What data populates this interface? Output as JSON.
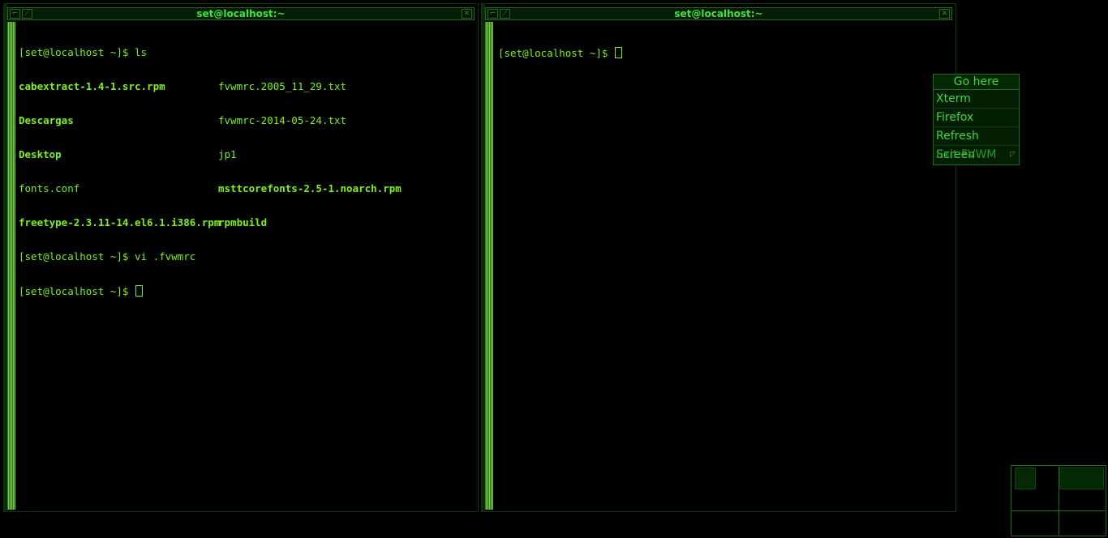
{
  "windows": [
    {
      "title": "set@localhost:~",
      "lines": [
        {
          "text": "[set@localhost ~]$ ls"
        },
        {
          "left": "cabextract-1.4-1.src.rpm",
          "right": "fvwmrc.2005_11_29.txt"
        },
        {
          "left": "Descargas",
          "right": "fvwmrc-2014-05-24.txt"
        },
        {
          "left": "Desktop",
          "right": "jp1"
        },
        {
          "left": "fonts.conf",
          "right": "msttcorefonts-2.5-1.noarch.rpm"
        },
        {
          "left": "freetype-2.3.11-14.el6.1.i386.rpm",
          "right": "rpmbuild"
        },
        {
          "text": "[set@localhost ~]$ vi .fvwmrc"
        },
        {
          "text": "[set@localhost ~]$ "
        }
      ]
    },
    {
      "title": "set@localhost:~",
      "lines": [
        {
          "text": "[set@localhost ~]$ "
        }
      ]
    }
  ],
  "menu": {
    "title": "Go here",
    "items": [
      "Xterm",
      "Firefox",
      "Refresh Screen",
      "Exit FVWM"
    ]
  },
  "colors": {
    "text": "#7ef218",
    "title": "#39e839",
    "border": "#1e6a1e",
    "background": "#000000"
  }
}
